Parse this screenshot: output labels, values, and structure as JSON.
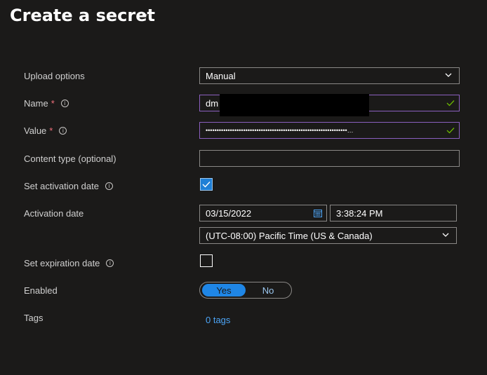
{
  "header": {
    "title": "Create a secret",
    "more": "···"
  },
  "form": {
    "upload_options": {
      "label": "Upload options",
      "value": "Manual"
    },
    "name": {
      "label": "Name",
      "required": "*",
      "value": "dm"
    },
    "value": {
      "label": "Value",
      "required": "*",
      "value": "••••••••••••••••••••••••••••••••••••••••••••••••••••••••••••••••…"
    },
    "content_type": {
      "label": "Content type (optional)",
      "value": ""
    },
    "set_activation": {
      "label": "Set activation date",
      "checked": true
    },
    "activation_date": {
      "label": "Activation date",
      "date": "03/15/2022",
      "time": "3:38:24 PM",
      "timezone": "(UTC-08:00) Pacific Time (US & Canada)"
    },
    "set_expiration": {
      "label": "Set expiration date",
      "checked": false
    },
    "enabled": {
      "label": "Enabled",
      "yes": "Yes",
      "no": "No",
      "selected": "Yes"
    },
    "tags": {
      "label": "Tags",
      "link": "0 tags"
    }
  },
  "colors": {
    "accent": "#1f86e6",
    "background": "#1b1a19",
    "valid_border": "#8b5fbf",
    "check": "#6bb700",
    "required": "#f1707b"
  },
  "icons": {
    "info": "info-icon",
    "chevron": "chevron-down-icon",
    "valid": "checkmark-icon",
    "calendar": "calendar-icon"
  }
}
